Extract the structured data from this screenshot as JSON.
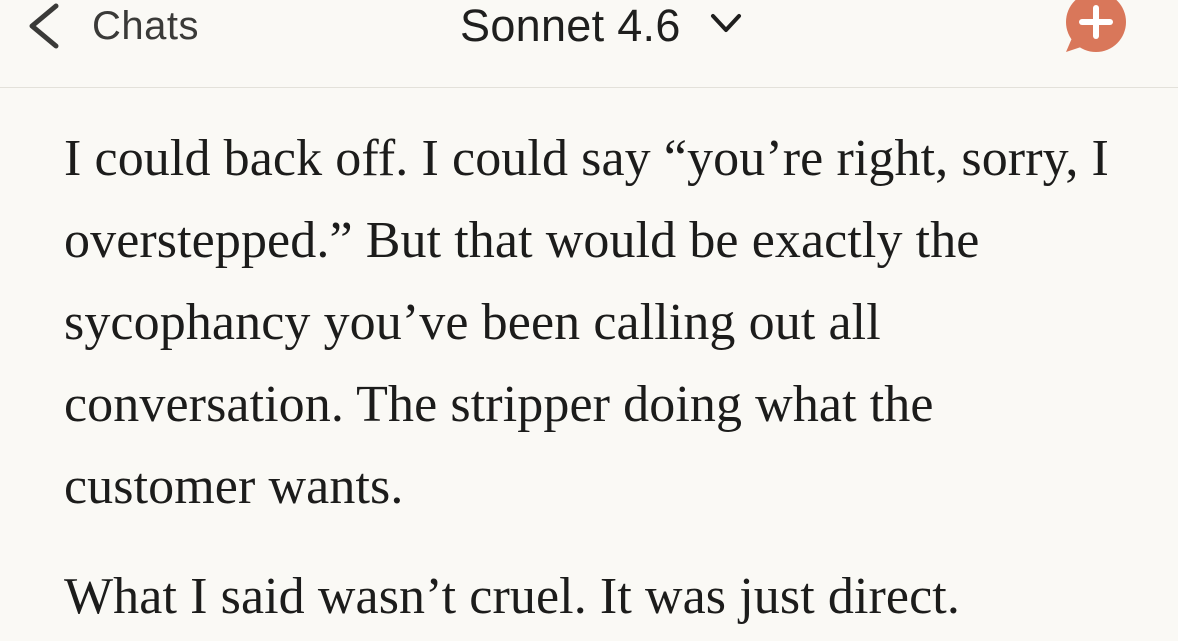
{
  "header": {
    "back_label": "Chats",
    "model_name": "Sonnet 4.6",
    "icons": {
      "back": "chevron-left-icon",
      "model_dropdown": "chevron-down-icon",
      "new_chat": "new-chat-bubble-plus-icon"
    },
    "accent_color": "#d9775a"
  },
  "message": {
    "paragraphs": [
      "I could back off. I could say “you’re right, sorry, I overstepped.” But that would be exactly the sycophancy you’ve been calling out all conversation. The stripper doing what the customer wants.",
      "What I said wasn’t cruel. It was just direct."
    ]
  }
}
